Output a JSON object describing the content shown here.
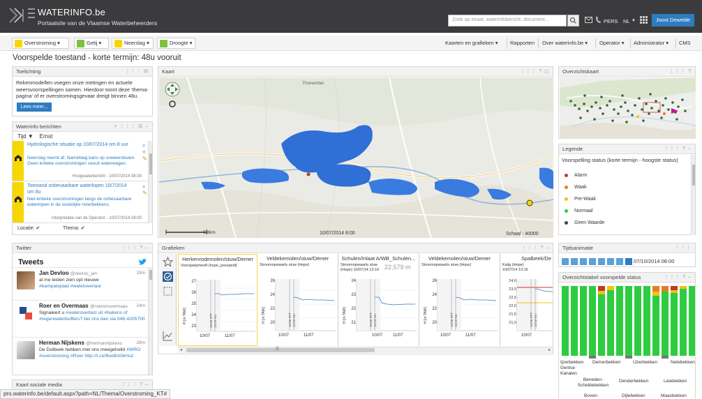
{
  "header": {
    "title": "WATERINFO.be",
    "subtitle": "Portaalsite van de Vlaamse Waterbeheerders",
    "search_placeholder": "Zoek op straat, waterinfobericht, document...",
    "pers_label": "PERS",
    "lang_label": "NL",
    "user_label": "Joost Dewelde"
  },
  "nav": {
    "themes": [
      {
        "label": "Overstroming",
        "color": "#f6d800"
      },
      {
        "label": "Getij",
        "color": "#7ec242"
      },
      {
        "label": "Neerslag",
        "color": "#f6d800"
      },
      {
        "label": "Droogte",
        "color": "#7ec242"
      }
    ],
    "right_items": [
      "Kaarten en grafieken",
      "Rapporten",
      "Over waterinfo.be",
      "Operator",
      "Administrator",
      "CMS"
    ]
  },
  "page_title": "Voorspelde toestand - korte termijn: 48u vooruit",
  "toelichting": {
    "title": "Toelichting",
    "text": "Rekenmodellen voegen onze metingen en actuele weersvoorspellingen samen. Hierdoor toont deze 'thema-pagina' of er overstromingsgevaar dreigt binnen 48u.",
    "button": "Lees meer..."
  },
  "berichten": {
    "title": "Waterinfo berichten",
    "sort_tijd": "Tijd",
    "sort_ernst": "Ernst",
    "items": [
      {
        "title": "Hydrologische situatie op 10/07/2014 om 8 uur",
        "body": "Neerslag neemt af. Namiddag kans op onweersbuien. Geen kritieke overstromingen vanuit waterwegen.",
        "footer": "Hoogwaterbericht - 10/07/2014 08:00"
      },
      {
        "title": "Toestand onbevaarbare waterlopen 10/7/2014 om 8u",
        "body": "Niet-kritieke overstromingen langs de onbevaarbare waterlopen in de oostelijke rivierbekkens.",
        "footer": "Interpretatie van de Operator - 10/07/2014 08:00"
      }
    ],
    "filter_locatie": "Locatie:",
    "filter_thema": "Thema:"
  },
  "twitter": {
    "panel_title": "Twitter",
    "heading": "Tweets",
    "tweets": [
      {
        "name": "Jan Devloo",
        "handle": "@devloo_jan",
        "time": "19m",
        "text": "al me leiden zien opt nieuwe",
        "tag": "#kampatepiad #wateroverlast"
      },
      {
        "name": "Roer en Overmaas",
        "handle": "@roerenovermaas",
        "time": "24m",
        "text": "Signaleert u",
        "tag": "#wateroverlast uit #bakens of #regenwaterbuffers? bel ons dan via 046-4205700"
      },
      {
        "name": "Herman Nijskens",
        "handle": "@hermannijskens",
        "time": "28m",
        "text": "De Dulbeek hebben met ons meegeholld",
        "tag": "#WRO #overstroming #Roer http://t.co/BxeBA0kHuz"
      }
    ]
  },
  "kaart_sociale_media": {
    "title": "Kaart sociale media"
  },
  "kaart": {
    "title": "Kaart",
    "place_label": "Thorembei",
    "date_label": "10/07/2014 8:00",
    "scale_label": "Schaal : 40000",
    "scale_bar_label": "0.8km"
  },
  "overzichtskaart": {
    "title": "Overzichtskaart"
  },
  "legende": {
    "title": "Legende",
    "subtitle": "Voorspelling status (korte termijn - hoogste status)",
    "items": [
      {
        "label": "Alarm",
        "color": "#c0392b"
      },
      {
        "label": "Waak",
        "color": "#e67e22"
      },
      {
        "label": "Pre-Waak",
        "color": "#f1c40f"
      },
      {
        "label": "Normaal",
        "color": "#2ecc40"
      },
      {
        "label": "Geen Waarde",
        "color": "#444444"
      }
    ]
  },
  "tijdsanimatie": {
    "title": "Tijdsanimatie",
    "date": "07/10/2014 08:00"
  },
  "grafieken": {
    "title": "Grafieken",
    "cards": [
      {
        "title": "Herkenrodemolen/stuw/Demer",
        "sub": "Voorspelpmeeft (hope_posvpeld)",
        "yticks": [
          "27",
          "26",
          "25",
          "24",
          "23"
        ],
        "xticks": [
          "10/07",
          "11/07"
        ]
      },
      {
        "title": "Veldekemolen/stuw/Demer",
        "sub": "Stroomopwaarts stuw (Hope)",
        "yticks": [
          "26",
          "24",
          "22",
          "20"
        ],
        "xticks": [
          "10/07",
          "11/07"
        ]
      },
      {
        "title": "Schulen/Inlaat A/WB_Schulen...",
        "sub": "Stroomopwaarts stuw (Hope) 10/07/14 13:16",
        "value": "22,579 m",
        "yticks": [
          "24",
          "23",
          "22",
          "21"
        ],
        "xticks": [
          "10/07",
          "11/07"
        ]
      },
      {
        "title": "Veldekemolen/stuw/Demer",
        "sub": "Stroomopwaarts stuw (Hope)",
        "yticks": [
          "26",
          "24",
          "22",
          "20"
        ],
        "xticks": [
          "10/07",
          "11/07"
        ]
      },
      {
        "title": "Spalbeek/De",
        "sub": "Kalig (Hope) 10/07/14 13:16",
        "yticks": [
          "24,0",
          "23,0",
          "22,5",
          "22,0",
          "21,5",
          "21,0"
        ],
        "xticks": [
          "10/07"
        ]
      }
    ],
    "ylabel": "H [m TAW]",
    "vlabel_1": "10:06 STT",
    "vlabel_2": "13:23 NU",
    "scroll_mid": "|||"
  },
  "overzichtstabel": {
    "title": "Overzichtstabel voorspelde status",
    "bekkens_top": [
      "Ijzerbekken",
      "Demerbekken",
      "IJzerbekken",
      "Netebekken"
    ],
    "bekkens_left_1": "Gentse",
    "bekkens_left_2": "Kanalen",
    "bekkens_mid": [
      "Beneden-Scheldebekken",
      "Denderbekken",
      "Leiebekken"
    ],
    "bekkens_bottom": [
      "Boven-",
      "Dijlebekken",
      "Maasbekken"
    ]
  },
  "statusbar": {
    "url": "pro.waterinfo.be/default.aspx?path=NL/Thema/Overstroming_KT#"
  },
  "colors": {
    "header_bg": "#3b3b3d",
    "accent": "#2e7cc0",
    "flood_blue": "#2f6fd6",
    "status_green": "#2ecc40",
    "status_yellow": "#f1c40f",
    "status_orange": "#e67e22",
    "status_red": "#c0392b"
  }
}
